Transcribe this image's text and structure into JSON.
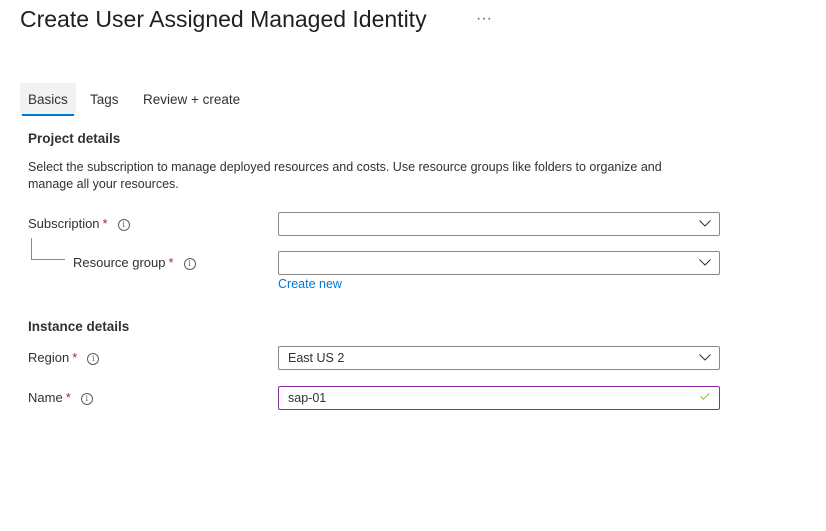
{
  "header": {
    "title": "Create User Assigned Managed Identity",
    "more": "···"
  },
  "tabs": [
    {
      "label": "Basics",
      "active": true
    },
    {
      "label": "Tags"
    },
    {
      "label": "Review + create"
    }
  ],
  "project": {
    "heading": "Project details",
    "description": "Select the subscription to manage deployed resources and costs. Use resource groups like folders to organize and manage all your resources.",
    "subscription": {
      "label": "Subscription",
      "value": ""
    },
    "resource_group": {
      "label": "Resource group",
      "value": "",
      "create_new": "Create new"
    }
  },
  "instance": {
    "heading": "Instance details",
    "region": {
      "label": "Region",
      "value": "East US 2"
    },
    "name": {
      "label": "Name",
      "value": "sap-01"
    }
  },
  "required_mark": "*",
  "info_glyph": "i",
  "colors": {
    "accent": "#0078d4",
    "required": "#a4262c",
    "valid": "#57a300",
    "focus": "#8a2da5"
  }
}
